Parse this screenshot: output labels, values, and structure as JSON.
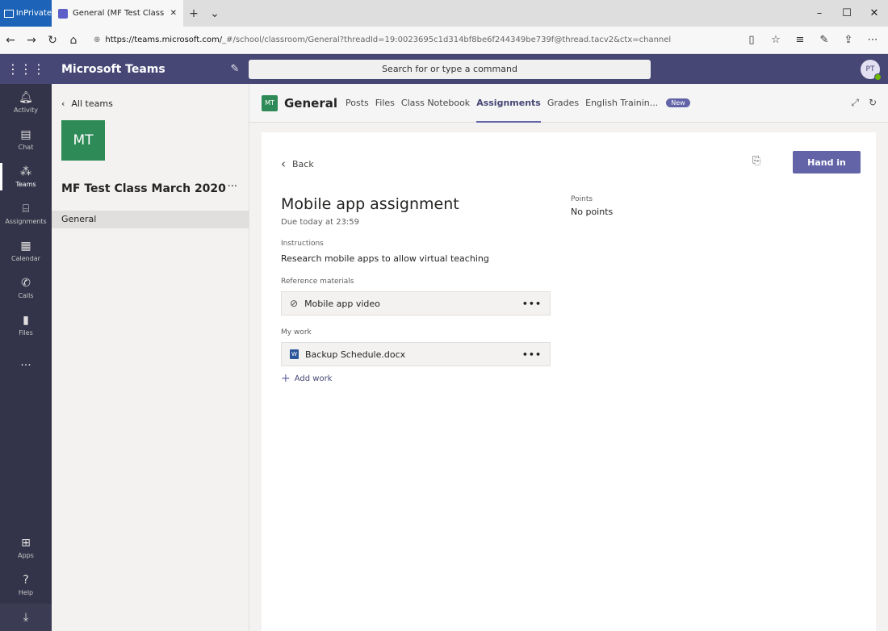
{
  "browser": {
    "inprivate_label": "InPrivate",
    "tab_title": "General (MF Test Class I",
    "url_host": "https://teams.microsoft.com/",
    "url_path": "_#/school/classroom/General?threadId=19:0023695c1d314bf8be6f244349be739f@thread.tacv2&ctx=channel"
  },
  "teams": {
    "app_title": "Microsoft Teams",
    "search_placeholder": "Search for or type a command",
    "avatar_initials": "PT"
  },
  "rail": {
    "items": [
      {
        "label": "Activity",
        "icon": "bell-icon"
      },
      {
        "label": "Chat",
        "icon": "chat-icon"
      },
      {
        "label": "Teams",
        "icon": "teams-icon"
      },
      {
        "label": "Assignments",
        "icon": "assignments-icon"
      },
      {
        "label": "Calendar",
        "icon": "calendar-icon"
      },
      {
        "label": "Calls",
        "icon": "phone-icon"
      },
      {
        "label": "Files",
        "icon": "files-icon"
      }
    ],
    "more": "...",
    "apps_label": "Apps",
    "help_label": "Help"
  },
  "panel": {
    "all_teams": "All teams",
    "team_initials": "MT",
    "team_name": "MF Test Class March 2020",
    "more": "···",
    "channel": "General"
  },
  "channel_header": {
    "badge": "MT",
    "title": "General",
    "tabs": [
      "Posts",
      "Files",
      "Class Notebook",
      "Assignments",
      "Grades",
      "English Trainin..."
    ],
    "new_badge": "New"
  },
  "assignment": {
    "back_label": "Back",
    "hand_in_label": "Hand in",
    "title": "Mobile app assignment",
    "due": "Due today at 23:59",
    "points_label": "Points",
    "points_value": "No points",
    "instructions_label": "Instructions",
    "instructions": "Research mobile apps to allow virtual teaching",
    "reference_label": "Reference materials",
    "reference_item": "Mobile app video",
    "my_work_label": "My work",
    "my_work_item": "Backup Schedule.docx",
    "add_work_label": "Add work",
    "more": "•••"
  }
}
